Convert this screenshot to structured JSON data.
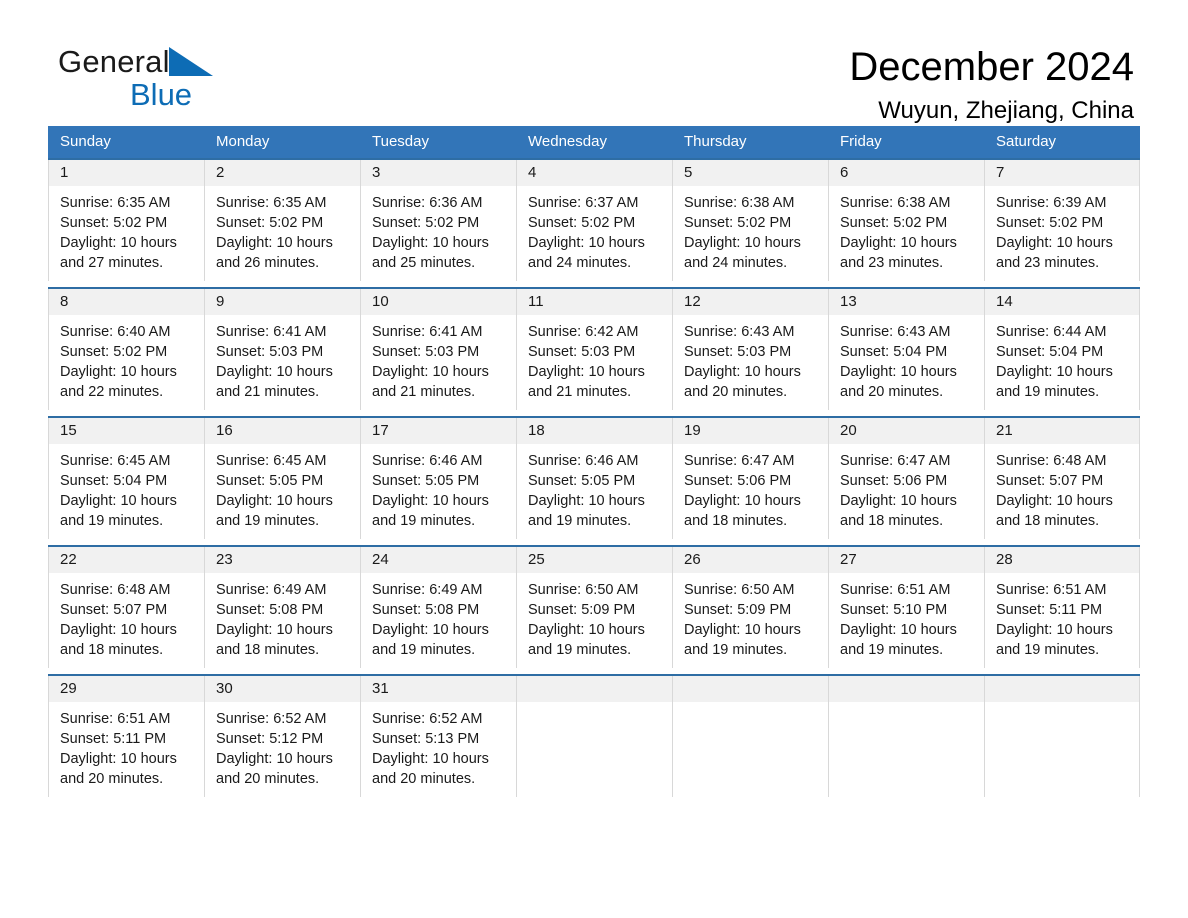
{
  "brand": {
    "name_part1": "General",
    "name_part2": "Blue",
    "flag_icon": "triangle-flag-icon",
    "accent_color": "#0d6cb5"
  },
  "header": {
    "title": "December 2024",
    "location": "Wuyun, Zhejiang, China"
  },
  "calendar": {
    "header_color": "#3275b8",
    "weekdays": [
      "Sunday",
      "Monday",
      "Tuesday",
      "Wednesday",
      "Thursday",
      "Friday",
      "Saturday"
    ],
    "weeks": [
      [
        {
          "day": "1",
          "sunrise": "Sunrise: 6:35 AM",
          "sunset": "Sunset: 5:02 PM",
          "daylight_line1": "Daylight: 10 hours",
          "daylight_line2": "and 27 minutes."
        },
        {
          "day": "2",
          "sunrise": "Sunrise: 6:35 AM",
          "sunset": "Sunset: 5:02 PM",
          "daylight_line1": "Daylight: 10 hours",
          "daylight_line2": "and 26 minutes."
        },
        {
          "day": "3",
          "sunrise": "Sunrise: 6:36 AM",
          "sunset": "Sunset: 5:02 PM",
          "daylight_line1": "Daylight: 10 hours",
          "daylight_line2": "and 25 minutes."
        },
        {
          "day": "4",
          "sunrise": "Sunrise: 6:37 AM",
          "sunset": "Sunset: 5:02 PM",
          "daylight_line1": "Daylight: 10 hours",
          "daylight_line2": "and 24 minutes."
        },
        {
          "day": "5",
          "sunrise": "Sunrise: 6:38 AM",
          "sunset": "Sunset: 5:02 PM",
          "daylight_line1": "Daylight: 10 hours",
          "daylight_line2": "and 24 minutes."
        },
        {
          "day": "6",
          "sunrise": "Sunrise: 6:38 AM",
          "sunset": "Sunset: 5:02 PM",
          "daylight_line1": "Daylight: 10 hours",
          "daylight_line2": "and 23 minutes."
        },
        {
          "day": "7",
          "sunrise": "Sunrise: 6:39 AM",
          "sunset": "Sunset: 5:02 PM",
          "daylight_line1": "Daylight: 10 hours",
          "daylight_line2": "and 23 minutes."
        }
      ],
      [
        {
          "day": "8",
          "sunrise": "Sunrise: 6:40 AM",
          "sunset": "Sunset: 5:02 PM",
          "daylight_line1": "Daylight: 10 hours",
          "daylight_line2": "and 22 minutes."
        },
        {
          "day": "9",
          "sunrise": "Sunrise: 6:41 AM",
          "sunset": "Sunset: 5:03 PM",
          "daylight_line1": "Daylight: 10 hours",
          "daylight_line2": "and 21 minutes."
        },
        {
          "day": "10",
          "sunrise": "Sunrise: 6:41 AM",
          "sunset": "Sunset: 5:03 PM",
          "daylight_line1": "Daylight: 10 hours",
          "daylight_line2": "and 21 minutes."
        },
        {
          "day": "11",
          "sunrise": "Sunrise: 6:42 AM",
          "sunset": "Sunset: 5:03 PM",
          "daylight_line1": "Daylight: 10 hours",
          "daylight_line2": "and 21 minutes."
        },
        {
          "day": "12",
          "sunrise": "Sunrise: 6:43 AM",
          "sunset": "Sunset: 5:03 PM",
          "daylight_line1": "Daylight: 10 hours",
          "daylight_line2": "and 20 minutes."
        },
        {
          "day": "13",
          "sunrise": "Sunrise: 6:43 AM",
          "sunset": "Sunset: 5:04 PM",
          "daylight_line1": "Daylight: 10 hours",
          "daylight_line2": "and 20 minutes."
        },
        {
          "day": "14",
          "sunrise": "Sunrise: 6:44 AM",
          "sunset": "Sunset: 5:04 PM",
          "daylight_line1": "Daylight: 10 hours",
          "daylight_line2": "and 19 minutes."
        }
      ],
      [
        {
          "day": "15",
          "sunrise": "Sunrise: 6:45 AM",
          "sunset": "Sunset: 5:04 PM",
          "daylight_line1": "Daylight: 10 hours",
          "daylight_line2": "and 19 minutes."
        },
        {
          "day": "16",
          "sunrise": "Sunrise: 6:45 AM",
          "sunset": "Sunset: 5:05 PM",
          "daylight_line1": "Daylight: 10 hours",
          "daylight_line2": "and 19 minutes."
        },
        {
          "day": "17",
          "sunrise": "Sunrise: 6:46 AM",
          "sunset": "Sunset: 5:05 PM",
          "daylight_line1": "Daylight: 10 hours",
          "daylight_line2": "and 19 minutes."
        },
        {
          "day": "18",
          "sunrise": "Sunrise: 6:46 AM",
          "sunset": "Sunset: 5:05 PM",
          "daylight_line1": "Daylight: 10 hours",
          "daylight_line2": "and 19 minutes."
        },
        {
          "day": "19",
          "sunrise": "Sunrise: 6:47 AM",
          "sunset": "Sunset: 5:06 PM",
          "daylight_line1": "Daylight: 10 hours",
          "daylight_line2": "and 18 minutes."
        },
        {
          "day": "20",
          "sunrise": "Sunrise: 6:47 AM",
          "sunset": "Sunset: 5:06 PM",
          "daylight_line1": "Daylight: 10 hours",
          "daylight_line2": "and 18 minutes."
        },
        {
          "day": "21",
          "sunrise": "Sunrise: 6:48 AM",
          "sunset": "Sunset: 5:07 PM",
          "daylight_line1": "Daylight: 10 hours",
          "daylight_line2": "and 18 minutes."
        }
      ],
      [
        {
          "day": "22",
          "sunrise": "Sunrise: 6:48 AM",
          "sunset": "Sunset: 5:07 PM",
          "daylight_line1": "Daylight: 10 hours",
          "daylight_line2": "and 18 minutes."
        },
        {
          "day": "23",
          "sunrise": "Sunrise: 6:49 AM",
          "sunset": "Sunset: 5:08 PM",
          "daylight_line1": "Daylight: 10 hours",
          "daylight_line2": "and 18 minutes."
        },
        {
          "day": "24",
          "sunrise": "Sunrise: 6:49 AM",
          "sunset": "Sunset: 5:08 PM",
          "daylight_line1": "Daylight: 10 hours",
          "daylight_line2": "and 19 minutes."
        },
        {
          "day": "25",
          "sunrise": "Sunrise: 6:50 AM",
          "sunset": "Sunset: 5:09 PM",
          "daylight_line1": "Daylight: 10 hours",
          "daylight_line2": "and 19 minutes."
        },
        {
          "day": "26",
          "sunrise": "Sunrise: 6:50 AM",
          "sunset": "Sunset: 5:09 PM",
          "daylight_line1": "Daylight: 10 hours",
          "daylight_line2": "and 19 minutes."
        },
        {
          "day": "27",
          "sunrise": "Sunrise: 6:51 AM",
          "sunset": "Sunset: 5:10 PM",
          "daylight_line1": "Daylight: 10 hours",
          "daylight_line2": "and 19 minutes."
        },
        {
          "day": "28",
          "sunrise": "Sunrise: 6:51 AM",
          "sunset": "Sunset: 5:11 PM",
          "daylight_line1": "Daylight: 10 hours",
          "daylight_line2": "and 19 minutes."
        }
      ],
      [
        {
          "day": "29",
          "sunrise": "Sunrise: 6:51 AM",
          "sunset": "Sunset: 5:11 PM",
          "daylight_line1": "Daylight: 10 hours",
          "daylight_line2": "and 20 minutes."
        },
        {
          "day": "30",
          "sunrise": "Sunrise: 6:52 AM",
          "sunset": "Sunset: 5:12 PM",
          "daylight_line1": "Daylight: 10 hours",
          "daylight_line2": "and 20 minutes."
        },
        {
          "day": "31",
          "sunrise": "Sunrise: 6:52 AM",
          "sunset": "Sunset: 5:13 PM",
          "daylight_line1": "Daylight: 10 hours",
          "daylight_line2": "and 20 minutes."
        },
        {
          "day": "",
          "sunrise": "",
          "sunset": "",
          "daylight_line1": "",
          "daylight_line2": ""
        },
        {
          "day": "",
          "sunrise": "",
          "sunset": "",
          "daylight_line1": "",
          "daylight_line2": ""
        },
        {
          "day": "",
          "sunrise": "",
          "sunset": "",
          "daylight_line1": "",
          "daylight_line2": ""
        },
        {
          "day": "",
          "sunrise": "",
          "sunset": "",
          "daylight_line1": "",
          "daylight_line2": ""
        }
      ]
    ]
  }
}
